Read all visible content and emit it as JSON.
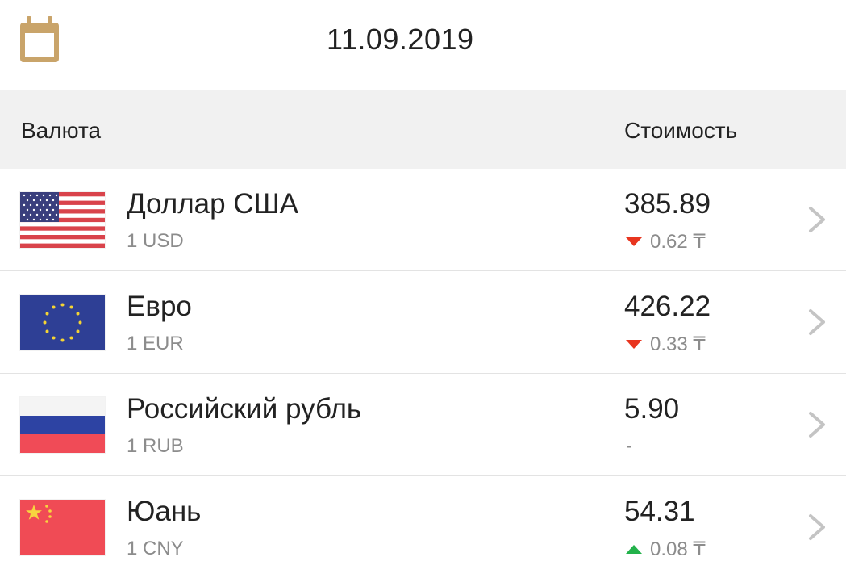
{
  "header": {
    "date": "11.09.2019"
  },
  "table": {
    "col_currency": "Валюта",
    "col_value": "Стоимость"
  },
  "rows": [
    {
      "flag": "us-flag-icon",
      "name": "Доллар США",
      "code": "1 USD",
      "price": "385.89",
      "direction": "down",
      "change": "0.62 ₸"
    },
    {
      "flag": "eu-flag-icon",
      "name": "Евро",
      "code": "1 EUR",
      "price": "426.22",
      "direction": "down",
      "change": "0.33 ₸"
    },
    {
      "flag": "ru-flag-icon",
      "name": "Российский рубль",
      "code": "1 RUB",
      "price": "5.90",
      "direction": "none",
      "change": "-"
    },
    {
      "flag": "cn-flag-icon",
      "name": "Юань",
      "code": "1 CNY",
      "price": "54.31",
      "direction": "up",
      "change": "0.08 ₸"
    }
  ],
  "colors": {
    "calendar_icon": "#c9a46a",
    "down": "#e8351f",
    "up": "#23b24b",
    "header_bg": "#f1f1f1",
    "secondary_text": "#8c8c8c"
  }
}
